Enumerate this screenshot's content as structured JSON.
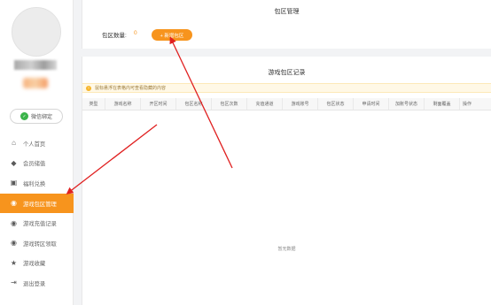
{
  "sidebar": {
    "wechat_label": "微信绑定",
    "items": [
      {
        "label": "个人首页",
        "icon": "home-icon"
      },
      {
        "label": "会员储值",
        "icon": "diamond-icon"
      },
      {
        "label": "福利兑换",
        "icon": "gift-icon"
      },
      {
        "label": "游戏包区管理",
        "icon": "gamepad-icon",
        "active": true
      },
      {
        "label": "游戏充值记录",
        "icon": "gamepad-icon"
      },
      {
        "label": "游戏转区领取",
        "icon": "gamepad-icon"
      },
      {
        "label": "游戏收藏",
        "icon": "star-icon"
      },
      {
        "label": "退出登录",
        "icon": "logout-icon"
      }
    ]
  },
  "top_panel": {
    "title": "包区管理",
    "count_label": "包区数量:",
    "count_value": "0",
    "new_button": "+ 新增包区"
  },
  "records": {
    "title": "游戏包区记录",
    "notice": "鼠标悬浮在表格内可查看隐藏的内容",
    "columns": [
      "类型",
      "游戏名称",
      "开区时间",
      "包区名称",
      "包区次数",
      "充值通道",
      "游戏账号",
      "包区状态",
      "申请时间",
      "加账号状态",
      "剩面覆盖",
      "操作"
    ],
    "empty_text": "暂无数据"
  },
  "colors": {
    "accent": "#f7941d",
    "annotation": "#e02020"
  }
}
